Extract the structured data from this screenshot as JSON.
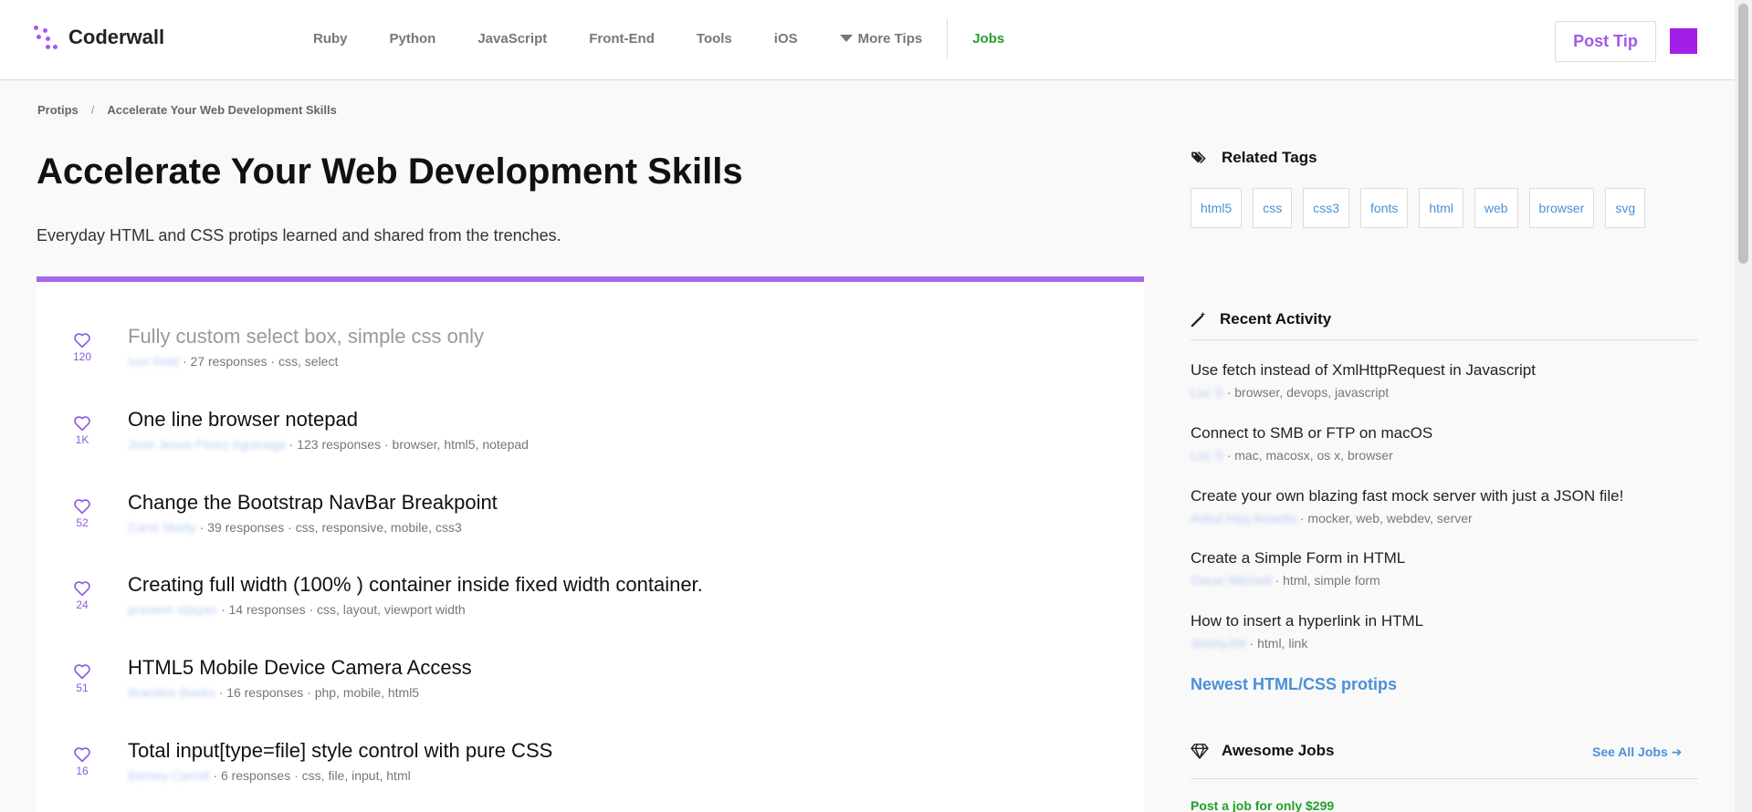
{
  "header": {
    "logo_text": "Coderwall",
    "nav": [
      "Ruby",
      "Python",
      "JavaScript",
      "Front-End",
      "Tools",
      "iOS"
    ],
    "more_tips": "More Tips",
    "jobs": "Jobs",
    "post_tip": "Post Tip",
    "avatar_color": "#a31ee6"
  },
  "breadcrumb": {
    "root": "Protips",
    "separator": "/",
    "current": "Accelerate Your Web Development Skills"
  },
  "main": {
    "title": "Accelerate Your Web Development Skills",
    "description": "Everyday HTML and CSS protips learned and shared from the trenches.",
    "accent_color": "#a667e8",
    "tips": [
      {
        "likes": "120",
        "title": "Fully custom select box, simple css only",
        "author": "Ivor Reid",
        "responses": "27 responses",
        "tags": "css, select"
      },
      {
        "likes": "1K",
        "title": "One line browser notepad",
        "author": "Jose Jesus Perez Aguinaga",
        "responses": "123 responses",
        "tags": "browser, html5, notepad"
      },
      {
        "likes": "52",
        "title": "Change the Bootstrap NavBar Breakpoint",
        "author": "Carol Skelly",
        "responses": "39 responses",
        "tags": "css, responsive, mobile, css3"
      },
      {
        "likes": "24",
        "title": "Creating full width (100% ) container inside fixed width container.",
        "author": "praveen vijayan",
        "responses": "14 responses",
        "tags": "css, layout, viewport width"
      },
      {
        "likes": "51",
        "title": "HTML5 Mobile Device Camera Access",
        "author": "Brandon Beeks",
        "responses": "16 responses",
        "tags": "php, mobile, html5"
      },
      {
        "likes": "16",
        "title": "Total input[type=file] style control with pure CSS",
        "author": "Barney Carroll",
        "responses": "6 responses",
        "tags": "css, file, input, html"
      }
    ]
  },
  "sidebar": {
    "related_tags_heading": "Related Tags",
    "tags": [
      "html5",
      "css",
      "css3",
      "fonts",
      "html",
      "web",
      "browser",
      "svg"
    ],
    "recent_activity_heading": "Recent Activity",
    "activity": [
      {
        "title": "Use fetch instead of XmlHttpRequest in Javascript",
        "author": "Luc S",
        "tags": "browser, devops, javascript"
      },
      {
        "title": "Connect to SMB or FTP on macOS",
        "author": "Luc S",
        "tags": "mac, macosx, os x, browser"
      },
      {
        "title": "Create your own blazing fast mock server with just a JSON file!",
        "author": "Ankul Haq Amanto",
        "tags": "mocker, web, webdev, server"
      },
      {
        "title": "Create a Simple Form in HTML",
        "author": "Oscar Mitchell",
        "tags": "html, simple form"
      },
      {
        "title": "How to insert a hyperlink in HTML",
        "author": "JimmyJW",
        "tags": "html, link"
      }
    ],
    "newest_link": "Newest HTML/CSS protips",
    "jobs_heading": "Awesome Jobs",
    "see_all_jobs": "See All Jobs",
    "post_job": "Post a job for only $299"
  }
}
